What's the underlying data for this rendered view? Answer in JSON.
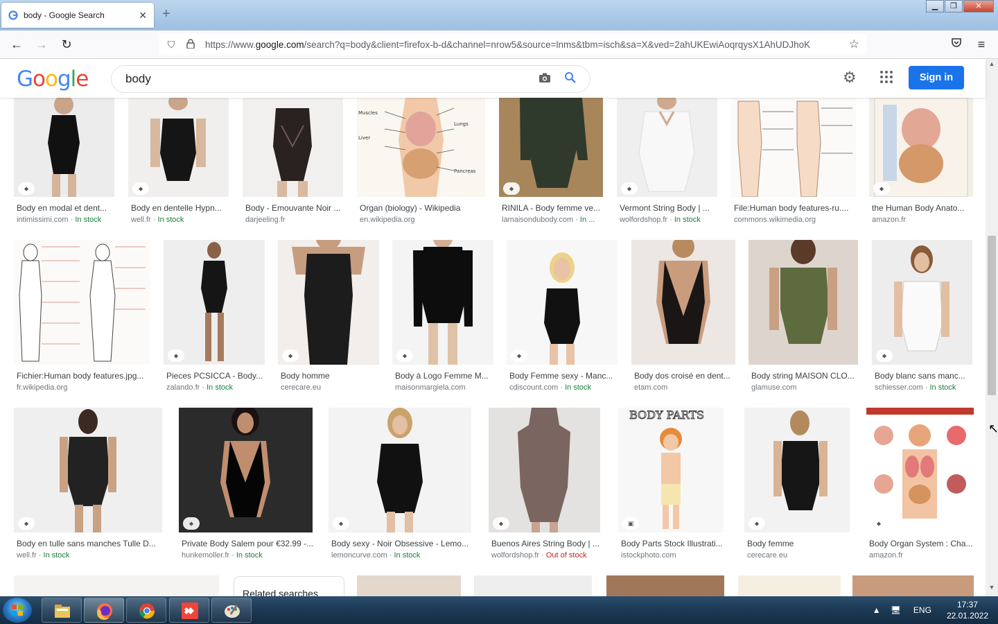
{
  "browser": {
    "tab_title": "body - Google Search",
    "tab_close": "✕",
    "new_tab": "+",
    "url_prefix": "https://www.",
    "url_host": "google.com",
    "url_rest": "/search?q=body&client=firefox-b-d&channel=nrow5&source=lnms&tbm=isch&sa=X&ved=2ahUKEwiAoqrqysX1AhUDJhoK"
  },
  "google": {
    "logo": [
      "G",
      "o",
      "o",
      "g",
      "l",
      "e"
    ],
    "query": "body",
    "sign_in": "Sign in"
  },
  "results": [
    {
      "caption": "Body en modal et dent...",
      "source": "intimissimi.com",
      "stock": "In stock",
      "stock_type": "in"
    },
    {
      "caption": "Body en dentelle Hypn...",
      "source": "well.fr",
      "stock": "In stock",
      "stock_type": "in"
    },
    {
      "caption": "Body - Emouvante Noir ...",
      "source": "darjeeling.fr",
      "stock": "",
      "stock_type": ""
    },
    {
      "caption": "Organ (biology) - Wikipedia",
      "source": "en.wikipedia.org",
      "stock": "",
      "stock_type": ""
    },
    {
      "caption": "RINILA - Body femme ve...",
      "source": "lamaisondubody.com",
      "stock": "In ...",
      "stock_type": "in"
    },
    {
      "caption": "Vermont String Body | ...",
      "source": "wolfordshop.fr",
      "stock": "In stock",
      "stock_type": "in"
    },
    {
      "caption": "File:Human body features-ru....",
      "source": "commons.wikimedia.org",
      "stock": "",
      "stock_type": ""
    },
    {
      "caption": "the Human Body Anato...",
      "source": "amazon.fr",
      "stock": "",
      "stock_type": ""
    },
    {
      "caption": "Fichier:Human body features.jpg...",
      "source": "fr.wikipedia.org",
      "stock": "",
      "stock_type": ""
    },
    {
      "caption": "Pieces PCSICCA - Body...",
      "source": "zalando.fr",
      "stock": "In stock",
      "stock_type": "in"
    },
    {
      "caption": "Body homme",
      "source": "cerecare.eu",
      "stock": "",
      "stock_type": ""
    },
    {
      "caption": "Body à Logo Femme M...",
      "source": "maisonmargiela.com",
      "stock": "",
      "stock_type": ""
    },
    {
      "caption": "Body Femme sexy - Manc...",
      "source": "cdiscount.com",
      "stock": "In stock",
      "stock_type": "in"
    },
    {
      "caption": "Body dos croisé en dent...",
      "source": "etam.com",
      "stock": "",
      "stock_type": ""
    },
    {
      "caption": "Body string MAISON CLO...",
      "source": "glamuse.com",
      "stock": "",
      "stock_type": ""
    },
    {
      "caption": "Body blanc sans manc...",
      "source": "schiesser.com",
      "stock": "In stock",
      "stock_type": "in"
    },
    {
      "caption": "Body en tulle sans manches Tulle D...",
      "source": "well.fr",
      "stock": "In stock",
      "stock_type": "in"
    },
    {
      "caption": "Private Body Salem pour €32.99 -...",
      "source": "hunkemoller.fr",
      "stock": "In stock",
      "stock_type": "in"
    },
    {
      "caption": "Body sexy - Noir Obsessive - Lemo...",
      "source": "lemoncurve.com",
      "stock": "In stock",
      "stock_type": "in"
    },
    {
      "caption": "Buenos Aires String Body | ...",
      "source": "wolfordshop.fr",
      "stock": "Out of stock",
      "stock_type": "out"
    },
    {
      "caption": "Body Parts Stock Illustrati...",
      "source": "istockphoto.com",
      "stock": "",
      "stock_type": ""
    },
    {
      "caption": "Body femme",
      "source": "cerecare.eu",
      "stock": "",
      "stock_type": ""
    },
    {
      "caption": "Body Organ System : Cha...",
      "source": "amazon.fr",
      "stock": "",
      "stock_type": ""
    }
  ],
  "related_searches": "Related searches",
  "taskbar": {
    "language": "ENG",
    "time": "17:37",
    "date": "22.01.2022"
  },
  "colors": {
    "accent": "#1a73e8",
    "in_stock": "#188038",
    "out_of_stock": "#c5221f"
  }
}
